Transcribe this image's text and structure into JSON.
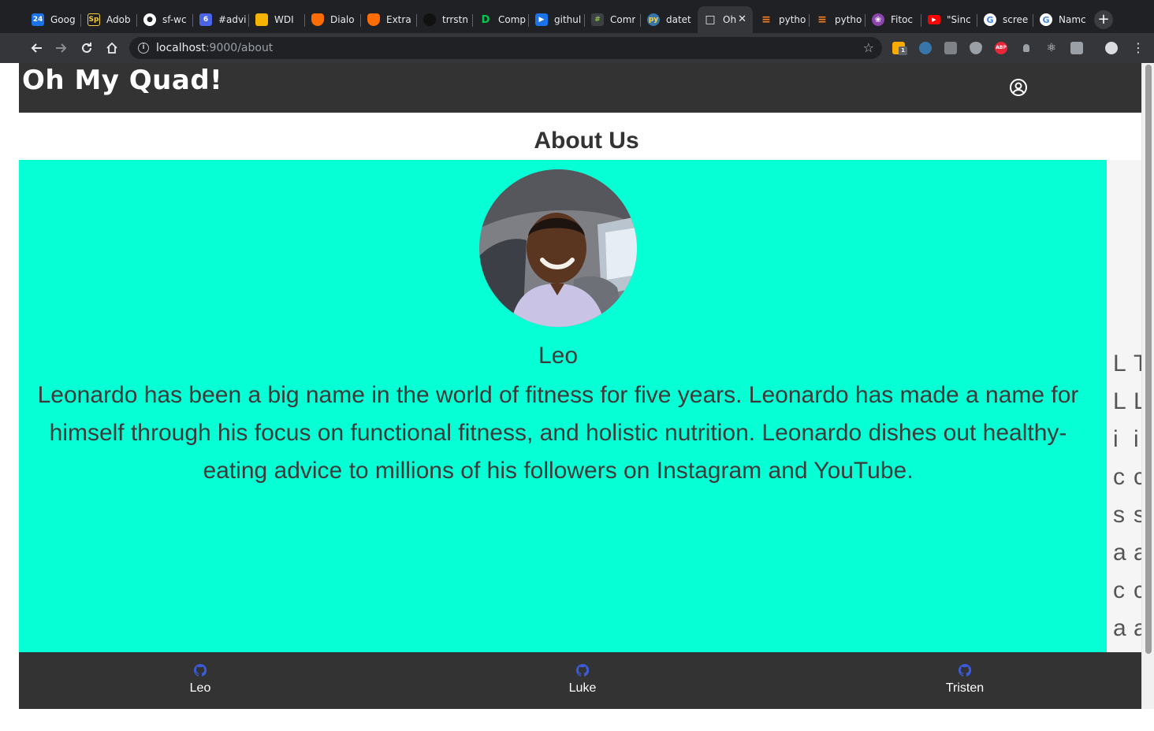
{
  "browser": {
    "tabs": [
      {
        "label": "Goog",
        "icon": "calendar-icon",
        "color": "#1a73e8",
        "glyph": "24"
      },
      {
        "label": "Adob",
        "icon": "adobe-spark-icon",
        "color": "#1e1e1e",
        "glyph": "Sp"
      },
      {
        "label": "sf-wc",
        "icon": "github-icon",
        "color": "#202124",
        "glyph": "●"
      },
      {
        "label": "#advi",
        "icon": "slack-icon",
        "color": "#4a64e8",
        "glyph": "6"
      },
      {
        "label": "WDI",
        "icon": "slides-icon",
        "color": "#f4b400",
        "glyph": ""
      },
      {
        "label": "Dialo",
        "icon": "dialogflow-icon",
        "color": "#ff6d00",
        "glyph": ""
      },
      {
        "label": "Extra",
        "icon": "dialogflow-icon",
        "color": "#ff6d00",
        "glyph": ""
      },
      {
        "label": "trrstn",
        "icon": "circle-icon",
        "color": "#111111",
        "glyph": ""
      },
      {
        "label": "Comp",
        "icon": "d-logo-icon",
        "color": "#202124",
        "glyph": "D"
      },
      {
        "label": "githul",
        "icon": "flag-icon",
        "color": "#1a73e8",
        "glyph": "▶"
      },
      {
        "label": "Comr",
        "icon": "grid-icon",
        "color": "#3c4043",
        "glyph": "#"
      },
      {
        "label": "datet",
        "icon": "python-icon",
        "color": "#3776ab",
        "glyph": "py"
      },
      {
        "label": "Oh",
        "icon": "page-icon",
        "color": "#35363a",
        "glyph": "□"
      },
      {
        "label": "pytho",
        "icon": "stackoverflow-icon",
        "color": "#202124",
        "glyph": "≡"
      },
      {
        "label": "pytho",
        "icon": "stackoverflow-icon",
        "color": "#202124",
        "glyph": "≡"
      },
      {
        "label": "Fitoc",
        "icon": "fitocracy-icon",
        "color": "#8e44ad",
        "glyph": "❀"
      },
      {
        "label": "\"Sinc",
        "icon": "youtube-icon",
        "color": "#ff0000",
        "glyph": "▶"
      },
      {
        "label": "scree",
        "icon": "google-icon",
        "color": "#ffffff",
        "glyph": "G"
      },
      {
        "label": "Namc",
        "icon": "google-icon",
        "color": "#ffffff",
        "glyph": "G"
      }
    ],
    "active_tab_close": "✕",
    "new_tab": "+",
    "url_host": "localhost",
    "url_path": ":9000/about",
    "bookmark": "☆",
    "ext_badge": "1",
    "ext_abp": "ABP",
    "menu": "⋮"
  },
  "site": {
    "logo": "Oh My Quad!",
    "accent": "#06ffd4",
    "page_title": "About Us"
  },
  "member": {
    "name": "Leo",
    "bio": "Leonardo has been a big name in the world of fitness for five years. Leonardo has made a name for himself through his focus on functional fitness, and holistic nutrition. Leonardo dishes out healthy-eating advice to millions of his followers on Instagram and YouTube."
  },
  "next_slide_peek": {
    "col1": "L\nL\ni\nc\ns\na\nc\na",
    "col2": "T\nL\ni\nc\ns\na\nc\na"
  },
  "footer": {
    "links": [
      {
        "name": "Leo",
        "icon": "github-icon"
      },
      {
        "name": "Luke",
        "icon": "github-icon"
      },
      {
        "name": "Tristen",
        "icon": "github-icon"
      }
    ]
  }
}
